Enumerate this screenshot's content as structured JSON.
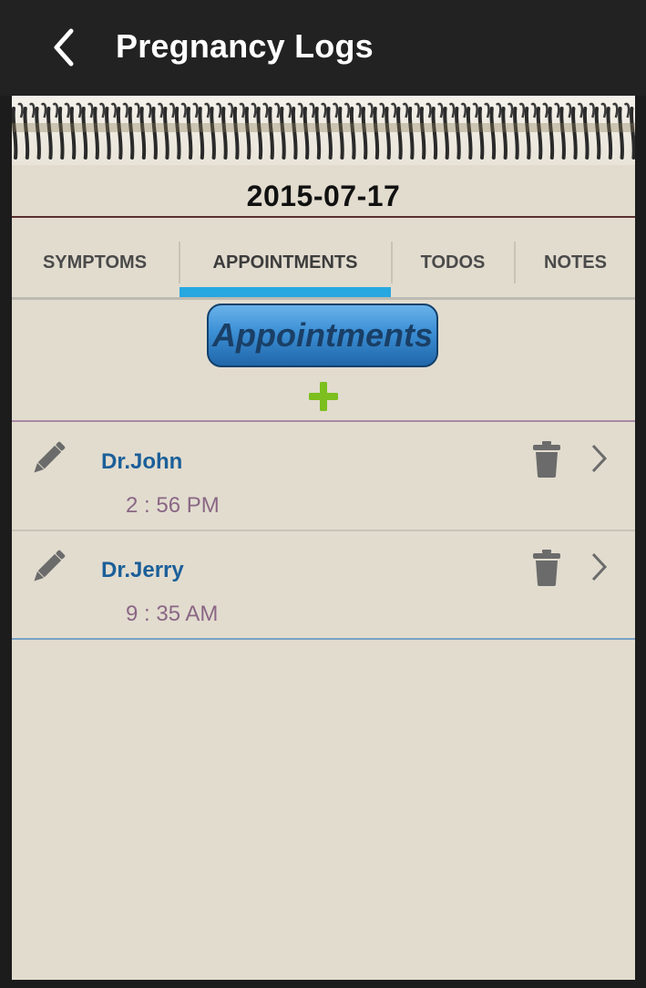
{
  "app_bar": {
    "title": "Pregnancy Logs"
  },
  "date": "2015-07-17",
  "tabs": [
    {
      "label": "SYMPTOMS"
    },
    {
      "label": "APPOINTMENTS"
    },
    {
      "label": "TODOS"
    },
    {
      "label": "NOTES"
    }
  ],
  "active_tab": "APPOINTMENTS",
  "section": {
    "title": "Appointments"
  },
  "appointments": [
    {
      "name": "Dr.John",
      "time": "2 : 56 PM"
    },
    {
      "name": "Dr.Jerry",
      "time": "9 : 35 AM"
    }
  ],
  "colors": {
    "accent": "#27a8e0",
    "name_text": "#1b5f99",
    "time_text": "#8a6785",
    "add_icon": "#7cbf1e",
    "paper": "#e2dccf"
  },
  "icons": {
    "back": "back-arrow-icon",
    "add": "plus-icon",
    "edit": "pencil-icon",
    "delete": "trash-icon",
    "open": "chevron-right-icon"
  }
}
